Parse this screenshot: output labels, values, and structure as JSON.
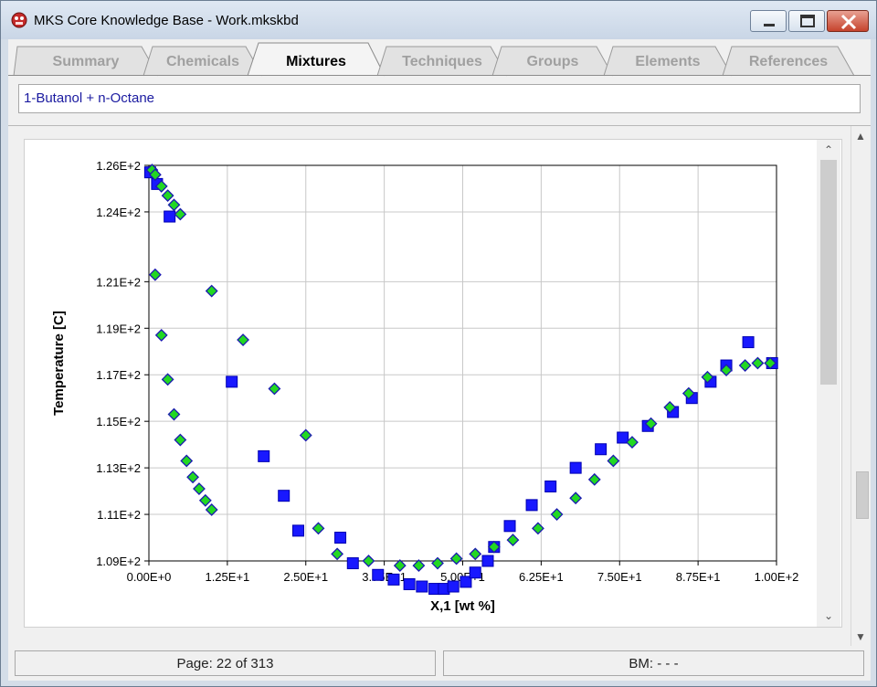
{
  "window": {
    "title": "MKS Core Knowledge Base - Work.mkskbd"
  },
  "tabs": [
    {
      "label": "Summary",
      "active": false
    },
    {
      "label": "Chemicals",
      "active": false
    },
    {
      "label": "Mixtures",
      "active": true
    },
    {
      "label": "Techniques",
      "active": false
    },
    {
      "label": "Groups",
      "active": false
    },
    {
      "label": "Elements",
      "active": false
    },
    {
      "label": "References",
      "active": false
    }
  ],
  "mixture": {
    "name": "1-Butanol + n-Octane"
  },
  "chart_data": {
    "type": "scatter",
    "xlabel": "X,1 [wt %]",
    "ylabel": "Temperature [C]",
    "xlim": [
      0,
      100
    ],
    "ylim": [
      109,
      126
    ],
    "x_ticks": [
      0,
      12.5,
      25,
      37.5,
      50,
      62.5,
      75,
      87.5,
      100
    ],
    "x_tick_labels": [
      "0.00E+0",
      "1.25E+1",
      "2.50E+1",
      "3.75E+1",
      "5.00E+1",
      "6.25E+1",
      "7.50E+1",
      "8.75E+1",
      "1.00E+2"
    ],
    "y_ticks": [
      109,
      111,
      113,
      115,
      117,
      119,
      121,
      124,
      126
    ],
    "y_tick_labels": [
      "1.09E+2",
      "1.11E+2",
      "1.13E+2",
      "1.15E+2",
      "1.17E+2",
      "1.19E+2",
      "1.21E+2",
      "1.24E+2",
      "1.26E+2"
    ],
    "grid": true,
    "series": [
      {
        "marker": "square",
        "color": "#1818ff",
        "points": [
          [
            0.2,
            125.7
          ],
          [
            1.3,
            125.2
          ],
          [
            3.3,
            123.8
          ],
          [
            13.2,
            116.7
          ],
          [
            18.3,
            113.5
          ],
          [
            21.5,
            111.8
          ],
          [
            23.8,
            110.3
          ],
          [
            30.5,
            110.0
          ],
          [
            32.5,
            108.9
          ],
          [
            36.5,
            108.4
          ],
          [
            39.0,
            108.2
          ],
          [
            41.5,
            108.0
          ],
          [
            43.5,
            107.9
          ],
          [
            45.5,
            107.8
          ],
          [
            47.0,
            107.8
          ],
          [
            48.5,
            107.9
          ],
          [
            50.5,
            108.1
          ],
          [
            52.0,
            108.5
          ],
          [
            54.0,
            109.0
          ],
          [
            55.0,
            109.6
          ],
          [
            57.5,
            110.5
          ],
          [
            61.0,
            111.4
          ],
          [
            64.0,
            112.2
          ],
          [
            68.0,
            113.0
          ],
          [
            72.0,
            113.8
          ],
          [
            75.5,
            114.3
          ],
          [
            79.5,
            114.8
          ],
          [
            83.5,
            115.4
          ],
          [
            86.5,
            116.0
          ],
          [
            89.5,
            116.7
          ],
          [
            92.0,
            117.4
          ],
          [
            95.5,
            118.4
          ],
          [
            99.3,
            117.5
          ]
        ]
      },
      {
        "marker": "diamond",
        "color": "#22d822",
        "points": [
          [
            0.5,
            125.8
          ],
          [
            1.0,
            125.6
          ],
          [
            2.0,
            125.1
          ],
          [
            3.0,
            124.7
          ],
          [
            4.0,
            124.3
          ],
          [
            5.0,
            123.9
          ],
          [
            1.0,
            121.3
          ],
          [
            2.0,
            118.7
          ],
          [
            3.0,
            116.8
          ],
          [
            4.0,
            115.3
          ],
          [
            5.0,
            114.2
          ],
          [
            6.0,
            113.3
          ],
          [
            7.0,
            112.6
          ],
          [
            8.0,
            112.1
          ],
          [
            9.0,
            111.6
          ],
          [
            10.0,
            111.2
          ],
          [
            10.0,
            120.6
          ],
          [
            15.0,
            118.5
          ],
          [
            20.0,
            116.4
          ],
          [
            25.0,
            114.4
          ],
          [
            27.0,
            110.4
          ],
          [
            30.0,
            109.3
          ],
          [
            35.0,
            109.0
          ],
          [
            40.0,
            108.8
          ],
          [
            43.0,
            108.8
          ],
          [
            46.0,
            108.9
          ],
          [
            49.0,
            109.1
          ],
          [
            52.0,
            109.3
          ],
          [
            55.0,
            109.6
          ],
          [
            58.0,
            109.9
          ],
          [
            62.0,
            110.4
          ],
          [
            65.0,
            111.0
          ],
          [
            68.0,
            111.7
          ],
          [
            71.0,
            112.5
          ],
          [
            74.0,
            113.3
          ],
          [
            77.0,
            114.1
          ],
          [
            80.0,
            114.9
          ],
          [
            83.0,
            115.6
          ],
          [
            86.0,
            116.2
          ],
          [
            89.0,
            116.9
          ],
          [
            92.0,
            117.2
          ],
          [
            95.0,
            117.4
          ],
          [
            97.0,
            117.5
          ],
          [
            99.0,
            117.5
          ]
        ]
      }
    ]
  },
  "status": {
    "page": "Page: 22 of 313",
    "bm": "BM: - - -"
  }
}
